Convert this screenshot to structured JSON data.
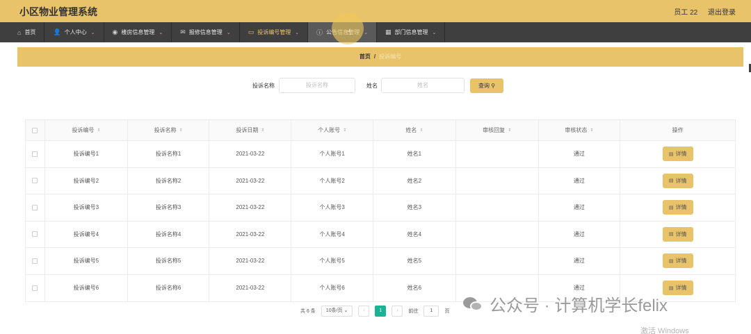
{
  "header": {
    "title": "小区物业管理系统",
    "user": "员工 22",
    "logout": "退出登录"
  },
  "nav": [
    {
      "label": "首页",
      "icon": "home-icon",
      "glyph": "⌂",
      "caret": false
    },
    {
      "label": "个人中心",
      "icon": "user-icon",
      "glyph": "👤",
      "caret": true
    },
    {
      "label": "楼房信息管理",
      "icon": "location-icon",
      "glyph": "◉",
      "caret": true
    },
    {
      "label": "报修信息管理",
      "icon": "mail-icon",
      "glyph": "✉",
      "caret": true
    },
    {
      "label": "投诉编号管理",
      "icon": "card-icon",
      "glyph": "▭",
      "caret": true
    },
    {
      "label": "公告信息管理",
      "icon": "info-icon",
      "glyph": "ⓘ",
      "caret": true
    },
    {
      "label": "部门信息管理",
      "icon": "grid-icon",
      "glyph": "▦",
      "caret": true
    }
  ],
  "breadcrumb": {
    "home": "首页",
    "separator": "/",
    "current": "投诉编号"
  },
  "search": {
    "label1": "投诉名称",
    "placeholder1": "投诉名称",
    "label2": "姓名",
    "placeholder2": "姓名",
    "button": "查询"
  },
  "table": {
    "columns": [
      "投诉编号",
      "投诉名称",
      "投诉日期",
      "个人账号",
      "姓名",
      "审核回复",
      "审核状态",
      "操作"
    ],
    "rows": [
      {
        "id": "投诉编号1",
        "name": "投诉名称1",
        "date": "2021-03-22",
        "account": "个人账号1",
        "person": "姓名1",
        "reply": "",
        "status": "通过",
        "action": "详情"
      },
      {
        "id": "投诉编号2",
        "name": "投诉名称2",
        "date": "2021-03-22",
        "account": "个人账号2",
        "person": "姓名2",
        "reply": "",
        "status": "通过",
        "action": "详情"
      },
      {
        "id": "投诉编号3",
        "name": "投诉名称3",
        "date": "2021-03-22",
        "account": "个人账号3",
        "person": "姓名3",
        "reply": "",
        "status": "通过",
        "action": "详情"
      },
      {
        "id": "投诉编号4",
        "name": "投诉名称4",
        "date": "2021-03-22",
        "account": "个人账号4",
        "person": "姓名4",
        "reply": "",
        "status": "通过",
        "action": "详情"
      },
      {
        "id": "投诉编号5",
        "name": "投诉名称5",
        "date": "2021-03-22",
        "account": "个人账号5",
        "person": "姓名5",
        "reply": "",
        "status": "通过",
        "action": "详情"
      },
      {
        "id": "投诉编号6",
        "name": "投诉名称6",
        "date": "2021-03-22",
        "account": "个人账号6",
        "person": "姓名6",
        "reply": "",
        "status": "通过",
        "action": "详情"
      }
    ]
  },
  "pagination": {
    "total": "共 6 条",
    "page_size": "10条/页",
    "current_page": "1",
    "goto_label": "前往",
    "goto_value": "1",
    "page_unit": "页"
  },
  "overlay": {
    "watermark": "公众号 · 计算机学长felix",
    "activation": "激活 Windows"
  },
  "colors": {
    "accent": "#e8c36a",
    "nav_bg": "#3f3f3f",
    "pager_active": "#1bb394"
  }
}
